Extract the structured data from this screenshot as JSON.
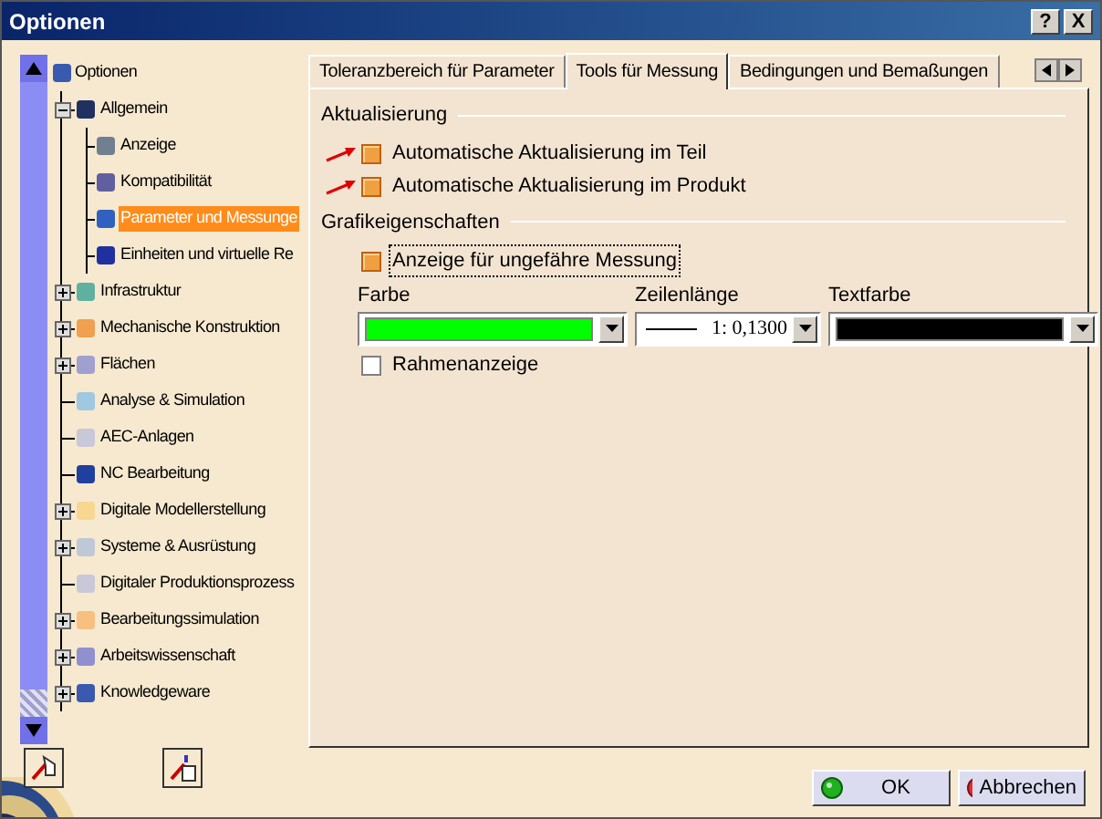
{
  "window": {
    "title": "Optionen",
    "help": "?",
    "close": "X"
  },
  "tree": {
    "label": "Optionen",
    "children": [
      {
        "label": "Allgemein",
        "kind": "folder",
        "expanded": true,
        "children": [
          {
            "label": "Anzeige",
            "kind": "leaf",
            "selected": false
          },
          {
            "label": "Kompatibilität",
            "kind": "leaf",
            "selected": false
          },
          {
            "label": "Parameter und Messunge",
            "kind": "leaf",
            "selected": true
          },
          {
            "label": "Einheiten und virtuelle Re",
            "kind": "leaf",
            "selected": false
          }
        ]
      },
      {
        "label": "Infrastruktur",
        "kind": "folder",
        "expanded": false
      },
      {
        "label": "Mechanische Konstruktion",
        "kind": "folder",
        "expanded": false
      },
      {
        "label": "Flächen",
        "kind": "folder",
        "expanded": false
      },
      {
        "label": "Analyse & Simulation",
        "kind": "leaf"
      },
      {
        "label": "AEC-Anlagen",
        "kind": "leaf"
      },
      {
        "label": "NC Bearbeitung",
        "kind": "leaf"
      },
      {
        "label": "Digitale Modellerstellung",
        "kind": "folder",
        "expanded": false
      },
      {
        "label": "Systeme & Ausrüstung",
        "kind": "folder",
        "expanded": false
      },
      {
        "label": "Digitaler Produktionsprozess",
        "kind": "leaf"
      },
      {
        "label": "Bearbeitungssimulation",
        "kind": "folder",
        "expanded": false
      },
      {
        "label": "Arbeitswissenschaft",
        "kind": "folder",
        "expanded": false
      },
      {
        "label": "Knowledgeware",
        "kind": "folder",
        "expanded": false
      }
    ]
  },
  "tabs": [
    {
      "label": "Toleranzbereich für Parameter",
      "selected": false
    },
    {
      "label": "Tools für Messung",
      "selected": true
    },
    {
      "label": "Bedingungen und Bemaßungen",
      "selected": false
    }
  ],
  "sections": [
    {
      "title": "Aktualisierung",
      "options": [
        {
          "label": "Automatische Aktualisierung im Teil",
          "checked": true,
          "marked": true,
          "focused": false
        },
        {
          "label": "Automatische Aktualisierung im Produkt",
          "checked": true,
          "marked": true,
          "focused": false
        }
      ]
    },
    {
      "title": "Grafikeigenschaften",
      "options": [
        {
          "label": "Anzeige für ungefähre Messung",
          "checked": true,
          "marked": false,
          "focused": true
        }
      ],
      "dropdowns": [
        {
          "label": "Farbe",
          "kind": "color",
          "color": "#00ff00"
        },
        {
          "label": "Zeilenlänge",
          "kind": "line",
          "value": "1: 0,1300"
        },
        {
          "label": "Textfarbe",
          "kind": "color",
          "color": "#000000"
        }
      ],
      "extra_options": [
        {
          "label": "Rahmenanzeige",
          "checked": false,
          "marked": false,
          "focused": false
        }
      ]
    }
  ],
  "buttons": [
    {
      "label": "OK",
      "kind": "ok"
    },
    {
      "label": "Abbrechen",
      "kind": "cancel"
    }
  ]
}
